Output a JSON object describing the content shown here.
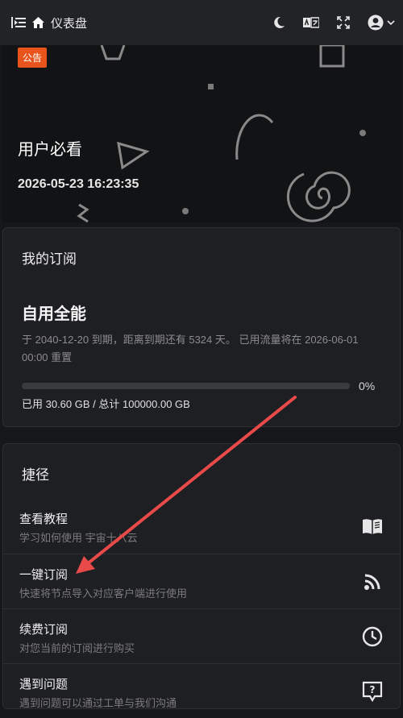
{
  "header": {
    "title": "仪表盘",
    "icons": [
      "menu-fold-icon",
      "home-icon",
      "moon-icon",
      "translate-icon",
      "fullscreen-icon",
      "user-avatar-icon",
      "chevron-down-icon"
    ]
  },
  "banner": {
    "badge": "公告",
    "title": "用户必看",
    "date": "2026-05-23 16:23:35"
  },
  "subscription": {
    "heading": "我的订阅",
    "plan": "自用全能",
    "description": "于 2040-12-20 到期，距离到期还有 5324 天。 已用流量将在 2026-06-01 00:00 重置",
    "progress_percent": 0,
    "progress_label": "0%",
    "usage": "已用 30.60 GB / 总计 100000.00 GB"
  },
  "shortcuts": {
    "heading": "捷径",
    "items": [
      {
        "title": "查看教程",
        "subtitle": "学习如何使用 宇宙十八云",
        "icon": "book-icon"
      },
      {
        "title": "一键订阅",
        "subtitle": "快速将节点导入对应客户端进行使用",
        "icon": "rss-icon"
      },
      {
        "title": "续费订阅",
        "subtitle": "对您当前的订阅进行购买",
        "icon": "clock-icon"
      },
      {
        "title": "遇到问题",
        "subtitle": "遇到问题可以通过工单与我们沟通",
        "icon": "question-message-icon"
      }
    ]
  },
  "colors": {
    "accent_badge": "#e8541b",
    "annotation_arrow": "#e84a4a",
    "progress": "#5b8def"
  }
}
